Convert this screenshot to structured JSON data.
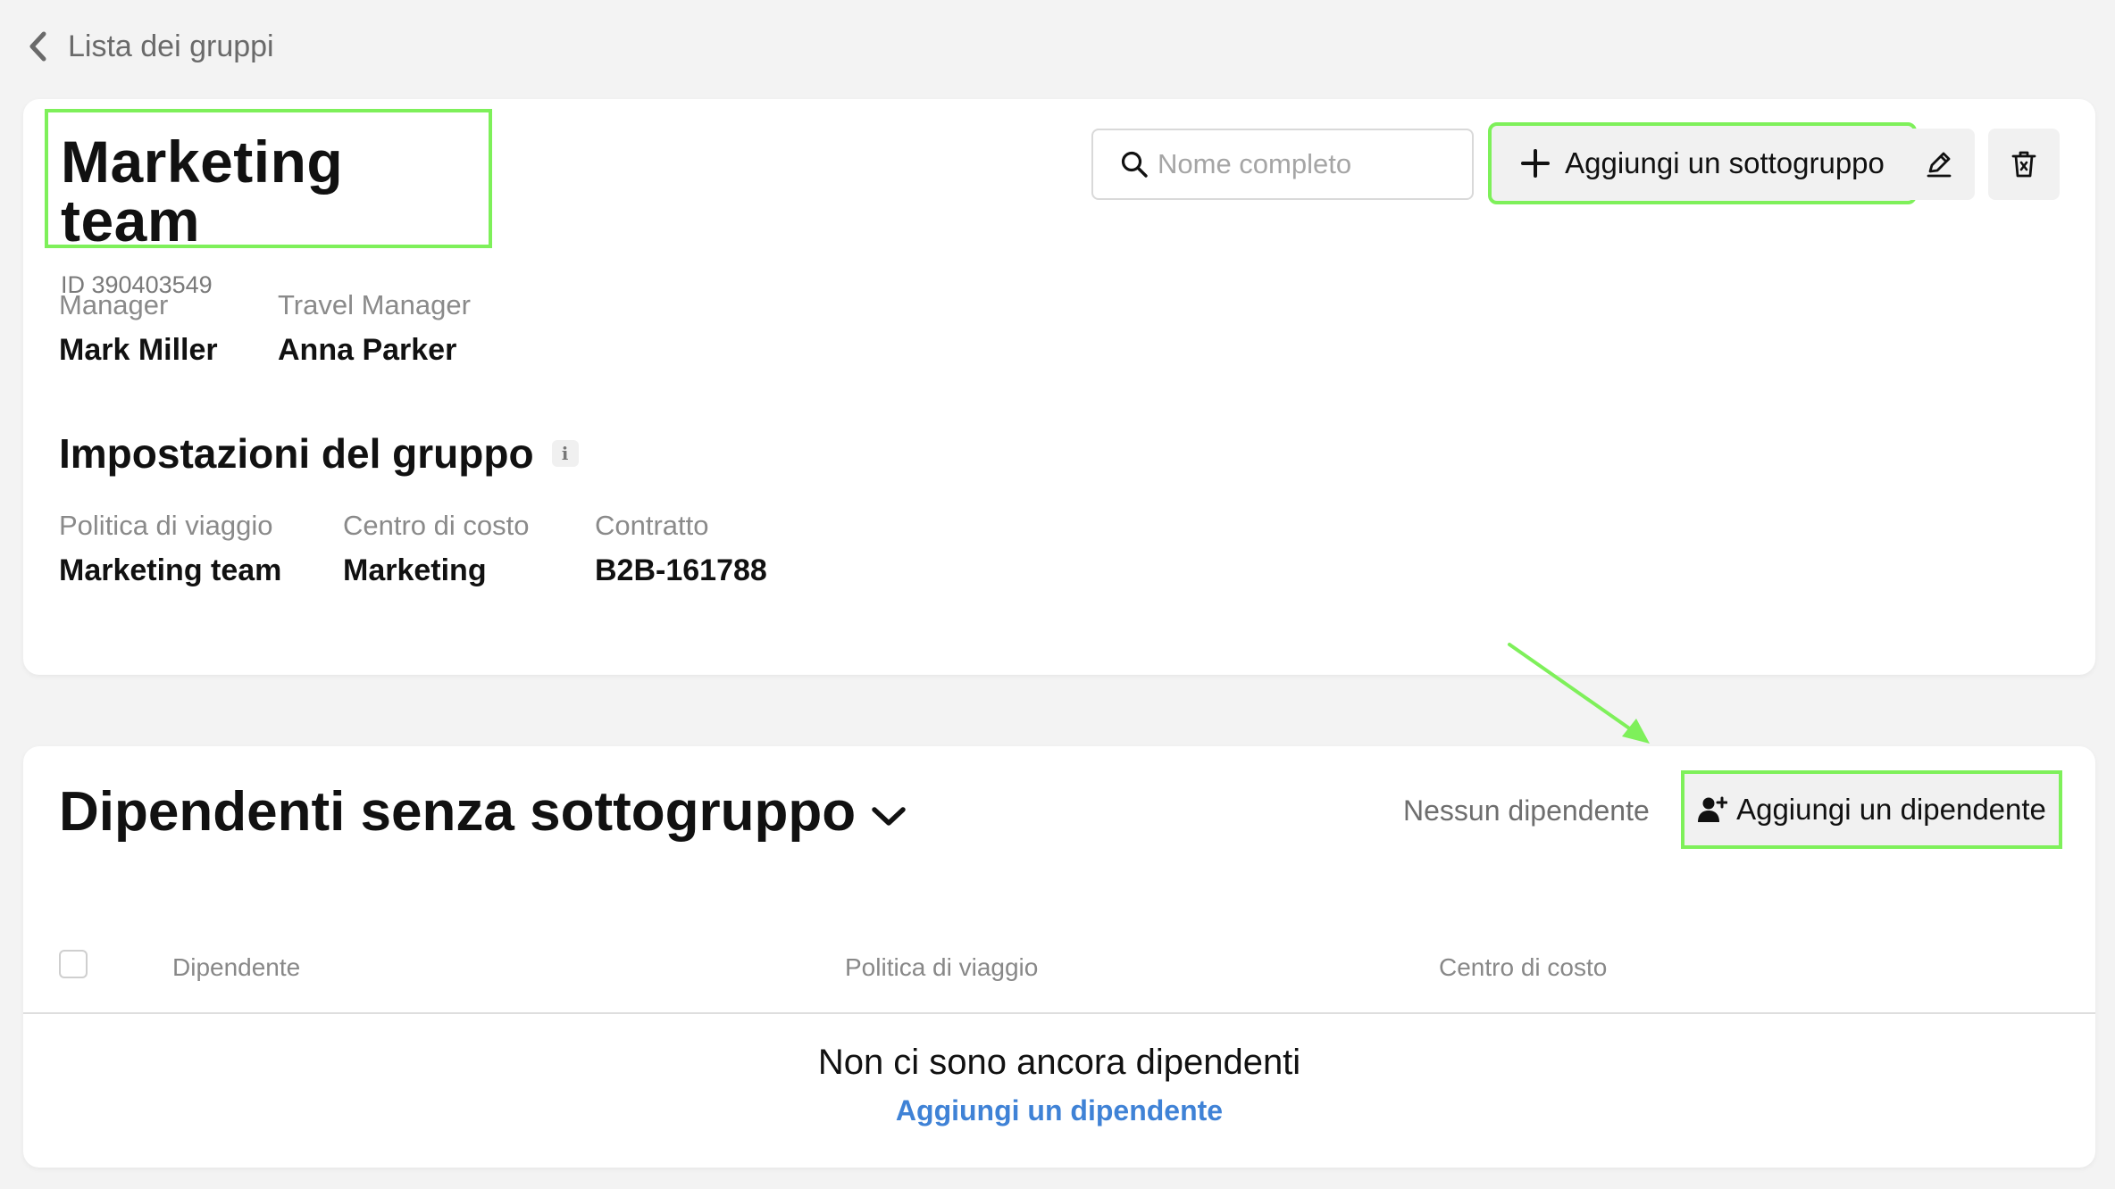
{
  "nav": {
    "back_label": "Lista dei gruppi"
  },
  "group": {
    "title": "Marketing team",
    "id_text": "ID 390403549",
    "manager_label": "Manager",
    "manager_value": "Mark Miller",
    "travel_manager_label": "Travel Manager",
    "travel_manager_value": "Anna Parker"
  },
  "toolbar": {
    "search_placeholder": "Nome completo",
    "add_subgroup_label": "Aggiungi un sottogruppo"
  },
  "settings": {
    "title": "Impostazioni del gruppo",
    "info_glyph": "i",
    "fields": [
      {
        "label": "Politica di viaggio",
        "value": "Marketing team"
      },
      {
        "label": "Centro di costo",
        "value": "Marketing"
      },
      {
        "label": "Contratto",
        "value": "B2B-161788"
      }
    ]
  },
  "employees": {
    "title": "Dipendenti senza sottogruppo",
    "status": "Nessun dipendente",
    "add_label": "Aggiungi un dipendente",
    "columns": [
      "Dipendente",
      "Politica di viaggio",
      "Centro di costo"
    ],
    "empty_message": "Non ci sono ancora dipendenti",
    "empty_link": "Aggiungi un dipendente"
  },
  "colors": {
    "highlight": "#7ef05a",
    "link": "#3f82d6",
    "background": "#f3f3f3"
  },
  "icons": [
    "chevron-left-icon",
    "search-icon",
    "plus-icon",
    "pencil-icon",
    "trash-icon",
    "chevron-down-icon",
    "user-plus-icon"
  ]
}
